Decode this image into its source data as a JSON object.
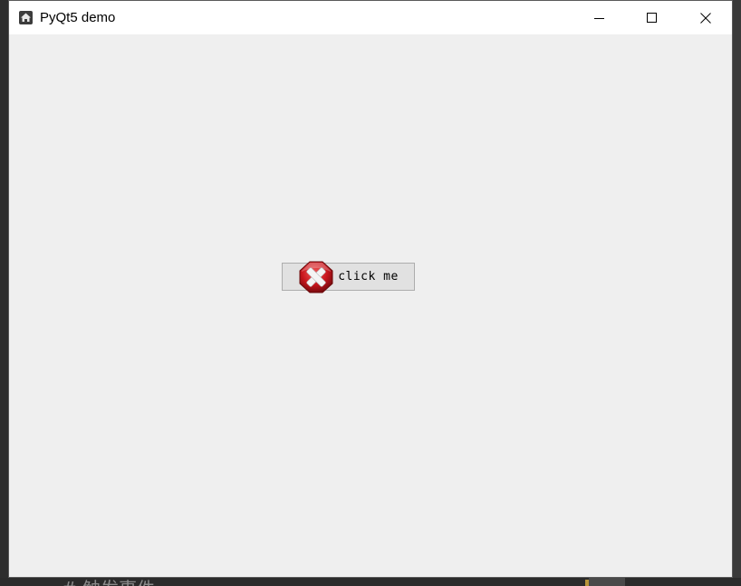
{
  "window": {
    "title": "PyQt5 demo",
    "icon": "app-home-icon",
    "controls": {
      "minimize_icon": "minimize-icon",
      "maximize_icon": "maximize-icon",
      "close_icon": "close-icon"
    }
  },
  "main": {
    "button": {
      "label": "click me",
      "icon": "error-x-icon"
    }
  },
  "background": {
    "partial_text": "# 触发事件"
  },
  "colors": {
    "client_bg": "#efefef",
    "button_bg": "#e1e1e1",
    "button_border": "#adadad",
    "icon_red": "#c8161d"
  }
}
